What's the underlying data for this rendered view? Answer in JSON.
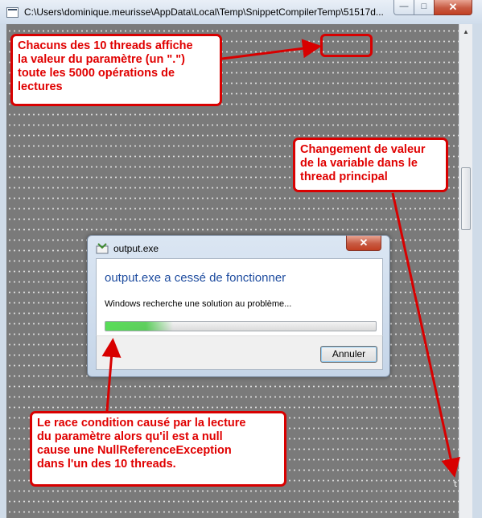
{
  "window": {
    "title": "C:\\Users\\dominique.meurisse\\AppData\\Local\\Temp\\SnippetCompilerTemp\\51517d...",
    "minimize_glyph": "—",
    "maximize_glyph": "□",
    "close_glyph": "✕",
    "console_cursor": "t"
  },
  "dialog": {
    "title": "output.exe",
    "close_glyph": "✕",
    "heading": "output.exe a cessé de fonctionner",
    "message": "Windows recherche une solution au problème...",
    "progress": 0.25,
    "cancel_label": "Annuler"
  },
  "annotations": {
    "threads": [
      "Chacuns des 10 threads affiche",
      "la valeur du paramètre (un \".\")",
      "toute les 5000 opérations de",
      "lectures"
    ],
    "change": [
      "Changement de valeur",
      "de la variable dans le",
      "thread principal"
    ],
    "race": [
      "Le race condition causé par la lecture",
      "du paramètre alors qu'il est a null",
      "cause une NullReferenceException",
      "dans l'un des 10 threads."
    ]
  },
  "colors": {
    "annotation": "#e00000",
    "dialog_heading": "#1e4c9f",
    "progress": "#3cc83c"
  }
}
